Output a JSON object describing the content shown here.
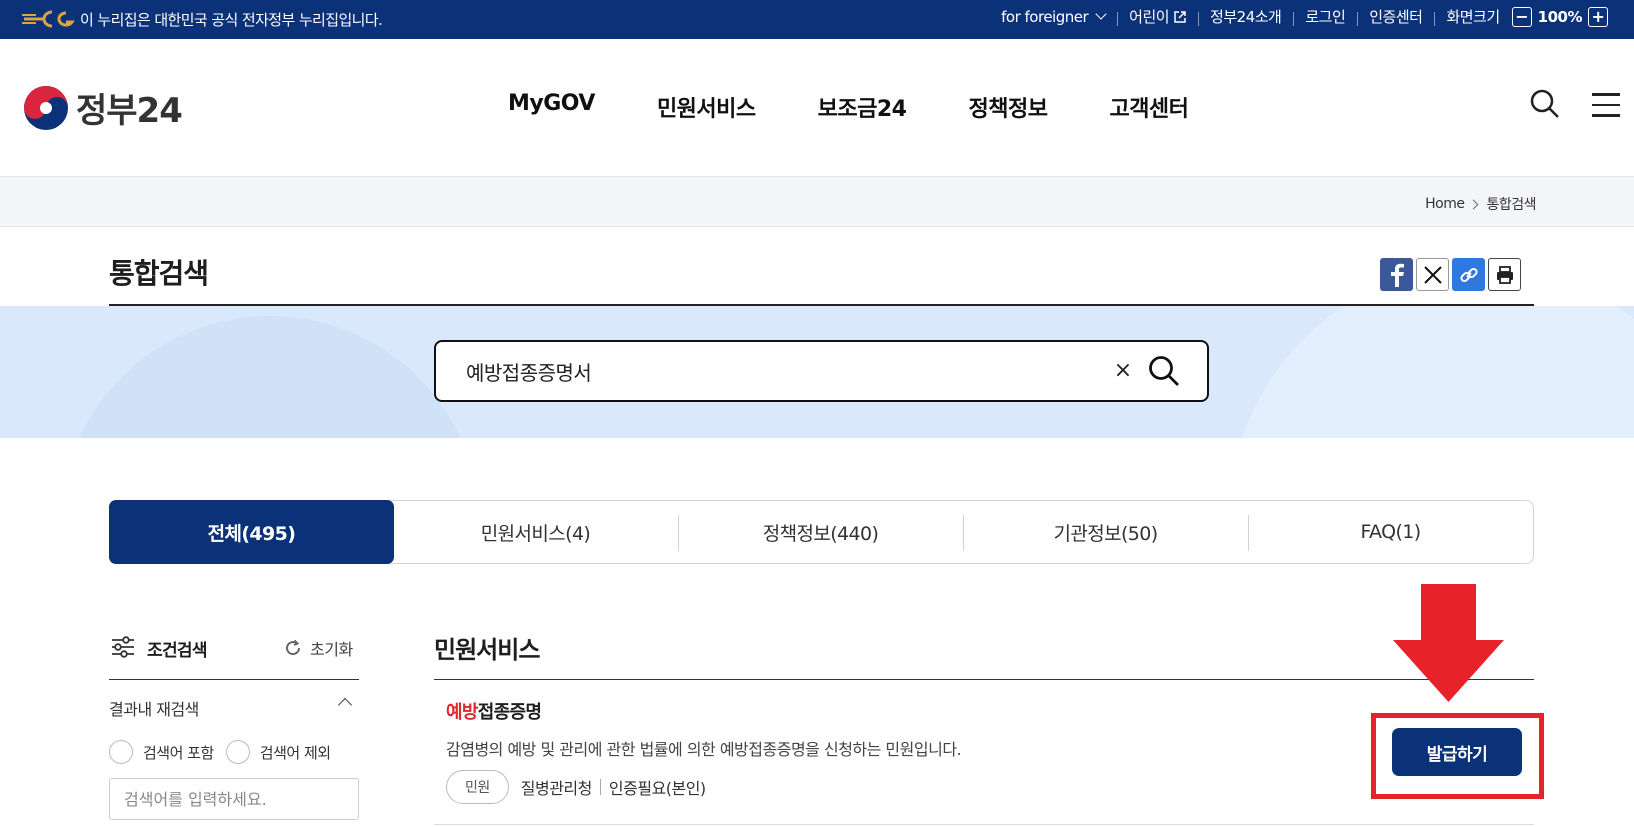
{
  "topbar": {
    "notice": "이 누리집은 대한민국 공식 전자정부 누리집입니다.",
    "links": {
      "foreigner": "for foreigner",
      "kids": "어린이",
      "about": "정부24소개",
      "login": "로그인",
      "cert": "인증센터",
      "screen_size": "화면크기"
    },
    "zoom": {
      "minus": "−",
      "value": "100%",
      "plus": "+"
    },
    "bg_color": "#0b3279"
  },
  "header": {
    "brand": "정부24",
    "gnb": [
      "MyGOV",
      "민원서비스",
      "보조금24",
      "정책정보",
      "고객센터"
    ]
  },
  "breadcrumb": {
    "home": "Home",
    "current": "통합검색"
  },
  "page_title": "통합검색",
  "search": {
    "value": "예방접종증명서",
    "clear": "×"
  },
  "tabs": [
    {
      "label": "전체(495)",
      "active": true
    },
    {
      "label": "민원서비스(4)",
      "active": false
    },
    {
      "label": "정책정보(440)",
      "active": false
    },
    {
      "label": "기관정보(50)",
      "active": false
    },
    {
      "label": "FAQ(1)",
      "active": false
    }
  ],
  "filter": {
    "title": "조건검색",
    "reset": "초기화",
    "refine_title": "결과내 재검색",
    "include": "검색어 포함",
    "exclude": "검색어 제외",
    "placeholder": "검색어를 입력하세요."
  },
  "section": {
    "title": "민원서비스",
    "result": {
      "title_highlight": "예방",
      "title_rest": "접종증명",
      "desc": "감염병의 예방 및 관리에 관한 법률에 의한 예방접종증명을 신청하는 민원입니다.",
      "badge": "민원",
      "agency": "질병관리청",
      "auth": "인증필요(본인)",
      "button": "발급하기"
    }
  },
  "colors": {
    "primary": "#0b3279",
    "highlight": "#e0282c",
    "annotation": "#e8222a"
  }
}
